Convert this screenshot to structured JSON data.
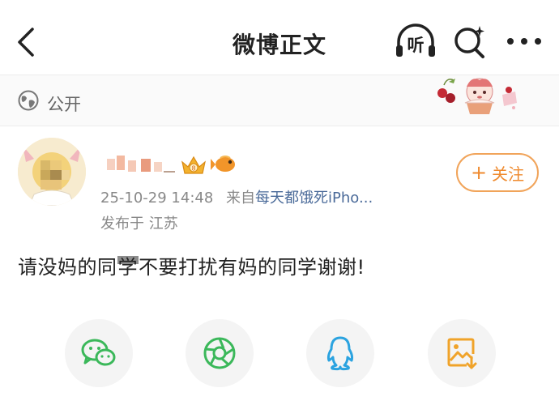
{
  "header": {
    "title": "微博正文",
    "listen_label": "听",
    "icons": [
      "back-icon",
      "headphones-listen-icon",
      "search-sparkle-icon",
      "more-dots-icon"
    ]
  },
  "visibility": {
    "label": "公开",
    "icon": "globe-icon"
  },
  "post": {
    "author_name_hidden": true,
    "meta": {
      "timestamp": "25-10-29 14:48",
      "source_prefix": "来自",
      "source_name": "每天都饿死iPho..."
    },
    "location": "发布于 江苏",
    "body_before": "请没妈的同",
    "body_obscured": "学",
    "body_after": "不要打扰有妈的同学谢谢!"
  },
  "follow": {
    "plus": "+",
    "label": "关注"
  },
  "share_bar": {
    "buttons": [
      "wechat-icon",
      "moments-icon",
      "qq-icon",
      "save-image-icon"
    ]
  },
  "colors": {
    "accent_orange": "#ef8a2e",
    "source_blue": "#4a6a99",
    "wechat_green": "#3bb85a",
    "qq_blue": "#2ba3e0",
    "save_orange": "#f0a32a"
  }
}
